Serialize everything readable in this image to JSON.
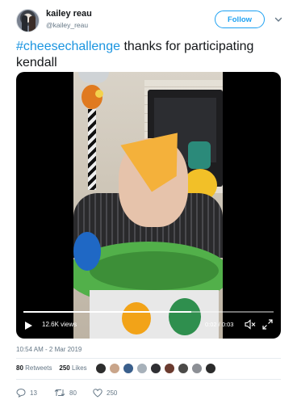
{
  "user": {
    "display_name": "kailey reau",
    "handle": "@kailey_reau",
    "follow_label": "Follow"
  },
  "tweet": {
    "hashtag": "#cheesechallenge",
    "text": " thanks for participating kendall"
  },
  "video": {
    "views": "12.6K views",
    "time": "0:02 / 0:03",
    "progress_fraction": 0.67
  },
  "meta": {
    "timestamp": "10:54 AM - 2 Mar 2019",
    "retweets_count": "80",
    "retweets_label": "Retweets",
    "likes_count": "250",
    "likes_label": "Likes",
    "liker_colors": [
      "#2d2d2d",
      "#c9a58a",
      "#3a5f8c",
      "#a7b1ba",
      "#2f2f33",
      "#6b3b2f",
      "#4b4a48",
      "#8c8f95",
      "#2b2b2b"
    ]
  },
  "actions": {
    "replies": "13",
    "retweets": "80",
    "likes": "250"
  },
  "colors": {
    "accent": "#1da1f2",
    "hashtag": "#1b95e0",
    "muted": "#657786"
  }
}
